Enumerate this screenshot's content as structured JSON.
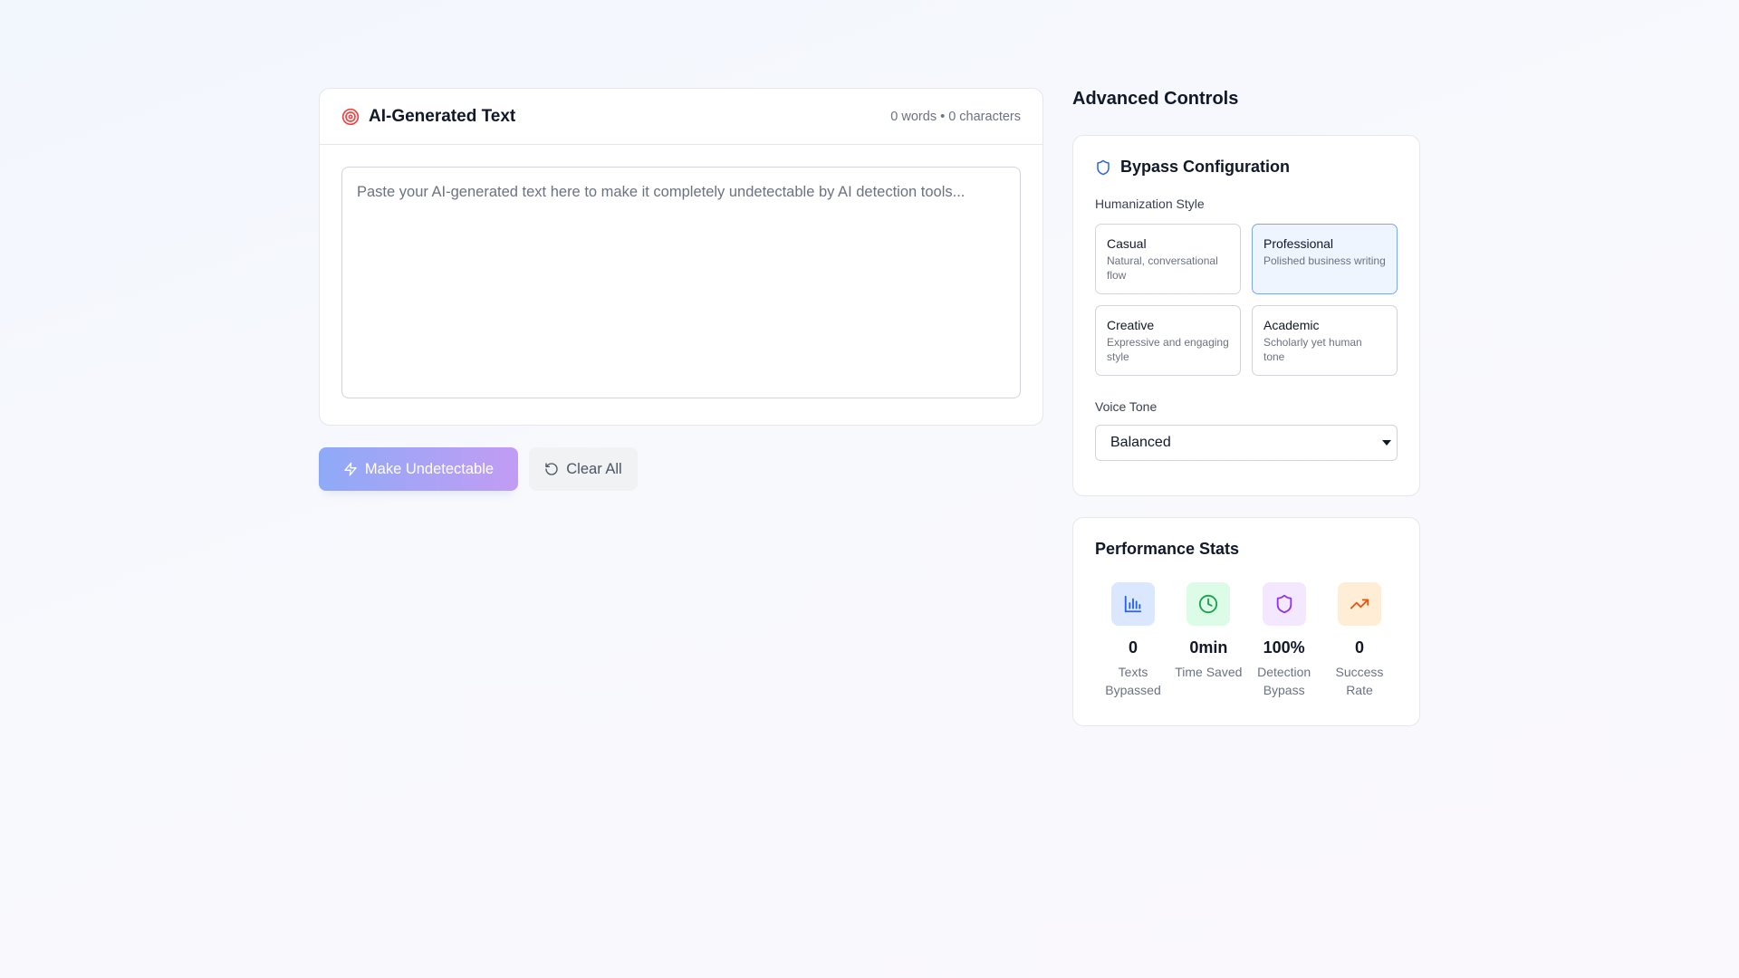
{
  "editor": {
    "title": "AI-Generated Text",
    "title_icon": "target-icon",
    "counter": "0 words • 0 characters",
    "placeholder": "Paste your AI-generated text here to make it completely undetectable by AI detection tools...",
    "value": ""
  },
  "actions": {
    "primary_label": "Make Undetectable",
    "primary_icon": "lightning-icon",
    "secondary_label": "Clear All",
    "secondary_icon": "rotate-ccw-icon"
  },
  "controls": {
    "heading": "Advanced Controls",
    "config": {
      "title": "Bypass Configuration",
      "title_icon": "shield-icon",
      "style_label": "Humanization Style",
      "styles": [
        {
          "name": "Casual",
          "desc": "Natural, conversational flow",
          "selected": false
        },
        {
          "name": "Professional",
          "desc": "Polished business writing",
          "selected": true
        },
        {
          "name": "Creative",
          "desc": "Expressive and engaging style",
          "selected": false
        },
        {
          "name": "Academic",
          "desc": "Scholarly yet human tone",
          "selected": false
        }
      ],
      "tone_label": "Voice Tone",
      "tone_value": "Balanced"
    },
    "stats": {
      "title": "Performance Stats",
      "items": [
        {
          "value": "0",
          "label": "Texts Bypassed",
          "icon": "bar-chart-icon",
          "color": "#2563eb",
          "bg": "#dbe7fc"
        },
        {
          "value": "0min",
          "label": "Time Saved",
          "icon": "clock-icon",
          "color": "#16a34a",
          "bg": "#dcfce7"
        },
        {
          "value": "100%",
          "label": "Detection Bypass",
          "icon": "shield-icon",
          "color": "#9333ea",
          "bg": "#f3e8ff"
        },
        {
          "value": "0",
          "label": "Success Rate",
          "icon": "trending-up-icon",
          "color": "#ea580c",
          "bg": "#ffedd5"
        }
      ]
    }
  }
}
